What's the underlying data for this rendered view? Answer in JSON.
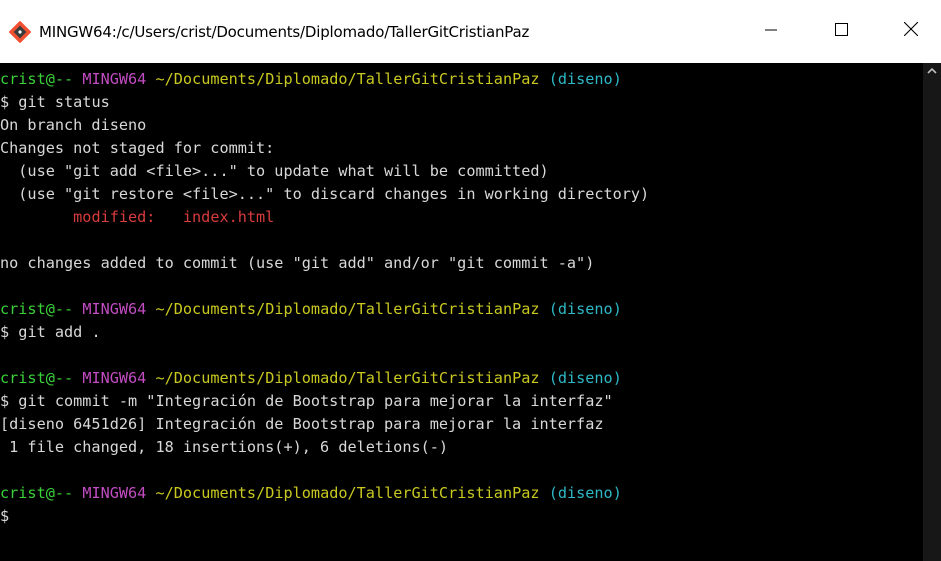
{
  "window": {
    "title": "MINGW64:/c/Users/crist/Documents/Diplomado/TallerGitCristianPaz",
    "icon": "git-bash-icon",
    "controls": [
      "minimize-icon",
      "maximize-icon",
      "close-icon"
    ]
  },
  "prompt": {
    "user_host": "crist@--",
    "system": "MINGW64",
    "path": "~/Documents/Diplomado/TallerGitCristianPaz",
    "branch": "(diseno)",
    "symbol": "$"
  },
  "terminal": {
    "cmd1": " git status",
    "out1_1": "On branch diseno",
    "out1_2": "Changes not staged for commit:",
    "out1_3": "  (use \"git add <file>...\" to update what will be committed)",
    "out1_4": "  (use \"git restore <file>...\" to discard changes in working directory)",
    "out1_5_indent": "        ",
    "out1_5_status": "modified:",
    "out1_5_gap": "   ",
    "out1_5_file": "index.html",
    "out1_6": "no changes added to commit (use \"git add\" and/or \"git commit -a\")",
    "cmd2": " git add .",
    "cmd3": " git commit -m \"Integración de Bootstrap para mejorar la interfaz\"",
    "out3_1": "[diseno 6451d26] Integración de Bootstrap para mejorar la interfaz",
    "out3_2": " 1 file changed, 18 insertions(+), 6 deletions(-)"
  },
  "colors": {
    "background": "#000000",
    "titlebar": "#ffffff",
    "user": "#3ad13a",
    "system": "#c24cc2",
    "path": "#c8c820",
    "branch": "#2fb8c6",
    "modified": "#d83c3c",
    "text": "#d8d8d8"
  }
}
